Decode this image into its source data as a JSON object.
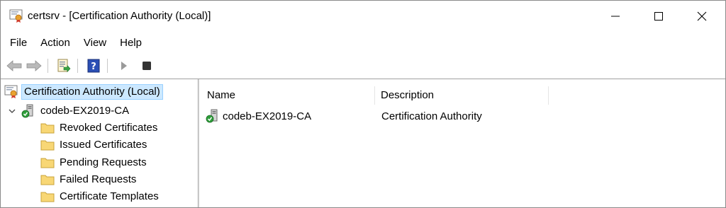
{
  "window": {
    "title": "certsrv - [Certification Authority (Local)]",
    "icons": {
      "app": "certsrv-icon",
      "minimize": "minimize-icon",
      "maximize": "maximize-icon",
      "close": "close-icon"
    }
  },
  "menubar": {
    "items": [
      {
        "label": "File"
      },
      {
        "label": "Action"
      },
      {
        "label": "View"
      },
      {
        "label": "Help"
      }
    ]
  },
  "toolbar": {
    "buttons": [
      "back-arrow-icon",
      "forward-arrow-icon",
      "export-list-icon",
      "help-icon",
      "start-service-icon",
      "stop-service-icon"
    ]
  },
  "tree": {
    "root": {
      "label": "Certification Authority (Local)",
      "selected": true
    },
    "ca": {
      "label": "codeb-EX2019-CA",
      "expanded": true
    },
    "folders": [
      {
        "label": "Revoked Certificates"
      },
      {
        "label": "Issued Certificates"
      },
      {
        "label": "Pending Requests"
      },
      {
        "label": "Failed Requests"
      },
      {
        "label": "Certificate Templates"
      }
    ]
  },
  "list": {
    "columns": [
      {
        "label": "Name"
      },
      {
        "label": "Description"
      }
    ],
    "rows": [
      {
        "name": "codeb-EX2019-CA",
        "description": "Certification Authority"
      }
    ]
  },
  "colors": {
    "selection_bg": "#cce8ff",
    "selection_border": "#99d1ff",
    "folder": "#f8d775",
    "help_blue": "#2b4fb5",
    "status_green": "#2e9e3a"
  }
}
